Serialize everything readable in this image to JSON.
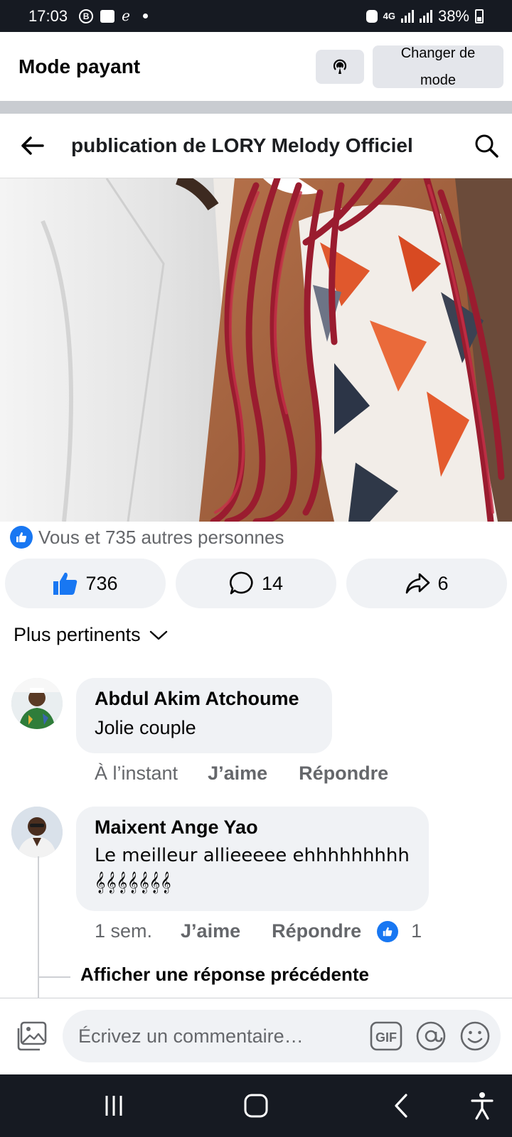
{
  "status_bar": {
    "time": "17:03",
    "network": "4G",
    "battery": "38%",
    "icons": [
      "b-icon",
      "gallery-icon",
      "signature-icon",
      "notification-dot",
      "alarm-icon",
      "signal-icon",
      "battery-icon"
    ]
  },
  "mode_bar": {
    "title": "Mode payant",
    "change_mode_label": "Changer de mode",
    "broadcast_icon": "broadcast-icon"
  },
  "header": {
    "title": "publication de LORY Melody Officiel",
    "back_icon": "back-arrow-icon",
    "search_icon": "search-icon"
  },
  "post": {
    "reactions_summary": "Vous et 735 autres personnes",
    "like_count": "736",
    "comment_count": "14",
    "share_count": "6"
  },
  "sort": {
    "label": "Plus pertinents"
  },
  "comments": [
    {
      "author": "Abdul Akim Atchoume",
      "text": "Jolie couple",
      "time": "À l’instant",
      "like_label": "J’aime",
      "reply_label": "Répondre"
    },
    {
      "author": "Maixent Ange Yao",
      "text": "Le meilleur allieeeee ehhhhhhhhh 𝄞𝄞𝄞𝄞𝄞𝄞𝄞",
      "time": "1 sem.",
      "like_label": "J’aime",
      "reply_label": "Répondre",
      "reaction_count": "1"
    }
  ],
  "show_previous_reply": "Afficher une réponse précédente",
  "composer": {
    "placeholder": "Écrivez un commentaire…",
    "gif_label": "GIF"
  },
  "colors": {
    "accent": "#1877f2",
    "bubble": "#f0f2f5",
    "secondary_text": "#65676b",
    "status_bar": "#161a22"
  }
}
